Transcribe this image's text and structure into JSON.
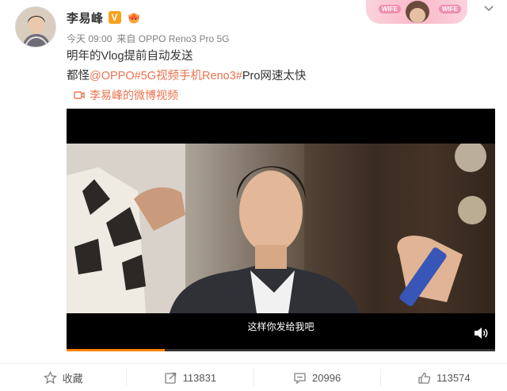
{
  "author": {
    "name": "李易峰",
    "verified_badge": "V",
    "badge_color": "#f7a11a"
  },
  "card_decor": {
    "tags": [
      "WIFE",
      "WIFE"
    ]
  },
  "post": {
    "time": "今天 09:00",
    "source_prefix": "来自",
    "device": "OPPO Reno3 Pro 5G",
    "text_line1": "明年的Vlog提前自动发送",
    "text_line2_prefix": "都怪",
    "mention": "@OPPO",
    "hashtag": "#5G视频手机Reno3#",
    "text_line2_suffix": "Pro网速太快",
    "video_source": "李易峰的微博视频",
    "link_color": "#eb7350"
  },
  "video": {
    "subtitle": "这样你发给我吧",
    "progress_percent": 23,
    "progress_color": "#ff8200"
  },
  "actions": {
    "favorite_label": "收藏",
    "repost_count": "113831",
    "comment_count": "20996",
    "like_count": "113574"
  }
}
